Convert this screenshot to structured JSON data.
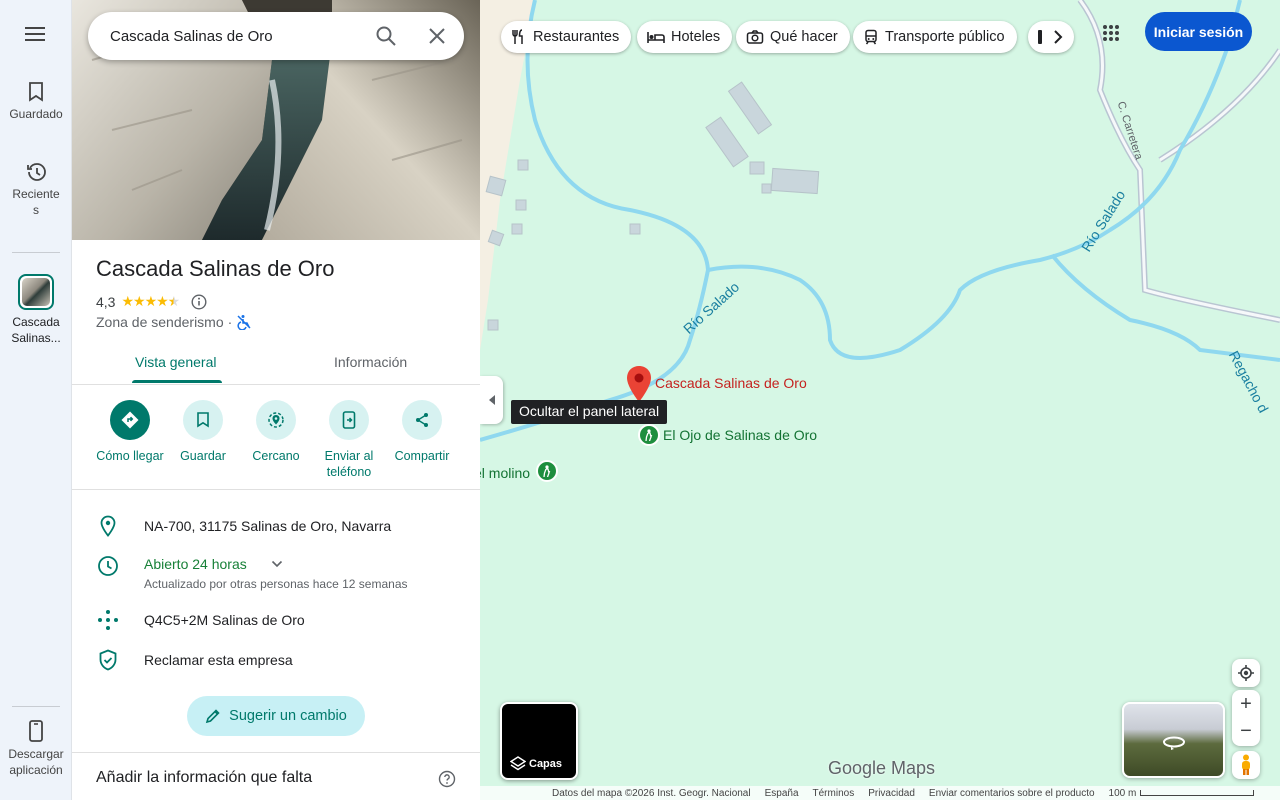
{
  "search": {
    "value": "Cascada Salinas de Oro"
  },
  "rail": {
    "saved": "Guardado",
    "recent": "Reciente\ns",
    "recent_place": "Cascada\nSalinas...",
    "download": "Descargar\naplicación"
  },
  "place": {
    "title": "Cascada Salinas de Oro",
    "rating": "4,3",
    "stars": 4.3,
    "category": "Zona de senderismo",
    "category_sep": "·"
  },
  "tabs": [
    {
      "label": "Vista general",
      "active": true
    },
    {
      "label": "Información",
      "active": false
    }
  ],
  "actions": [
    {
      "label": "Cómo llegar",
      "icon": "directions-icon"
    },
    {
      "label": "Guardar",
      "icon": "bookmark-icon"
    },
    {
      "label": "Cercano",
      "icon": "nearby-icon"
    },
    {
      "label": "Enviar al\nteléfono",
      "icon": "send-to-phone-icon"
    },
    {
      "label": "Compartir",
      "icon": "share-icon"
    }
  ],
  "info": {
    "address": "NA-700, 31175 Salinas de Oro, Navarra",
    "hours": "Abierto 24 horas",
    "hours_note": "Actualizado por otras personas hace 12 semanas",
    "plus_code": "Q4C5+2M Salinas de Oro",
    "claim": "Reclamar esta empresa"
  },
  "suggest_label": "Sugerir un cambio",
  "missing_info_label": "Añadir la información que falta",
  "chips": [
    {
      "label": "Restaurantes",
      "icon": "restaurant-icon"
    },
    {
      "label": "Hoteles",
      "icon": "hotel-icon"
    },
    {
      "label": "Qué hacer",
      "icon": "camera-icon"
    },
    {
      "label": "Transporte público",
      "icon": "transit-icon"
    }
  ],
  "signin_label": "Iniciar sesión",
  "tooltip": "Ocultar el panel lateral",
  "map_labels": {
    "pin": "Cascada Salinas de Oro",
    "ojo": "El Ojo de Salinas de Oro",
    "molino": "el molino",
    "rio1": "Río Salado",
    "rio2": "Río Salado",
    "carretera": "C. Carretera",
    "regacho": "Regacho d"
  },
  "layers_label": "Capas",
  "logo": "Google Maps",
  "footer": {
    "data": "Datos del mapa ©2026 Inst. Geogr. Nacional",
    "country": "España",
    "terms": "Términos",
    "privacy": "Privacidad",
    "feedback": "Enviar comentarios sobre el producto",
    "scale": "100 m"
  },
  "colors": {
    "accent": "#00796b",
    "primary": "#0b57d0",
    "pin": "#ea4335",
    "river": "#8fd8ef",
    "map_bg": "#d6f7e5"
  }
}
